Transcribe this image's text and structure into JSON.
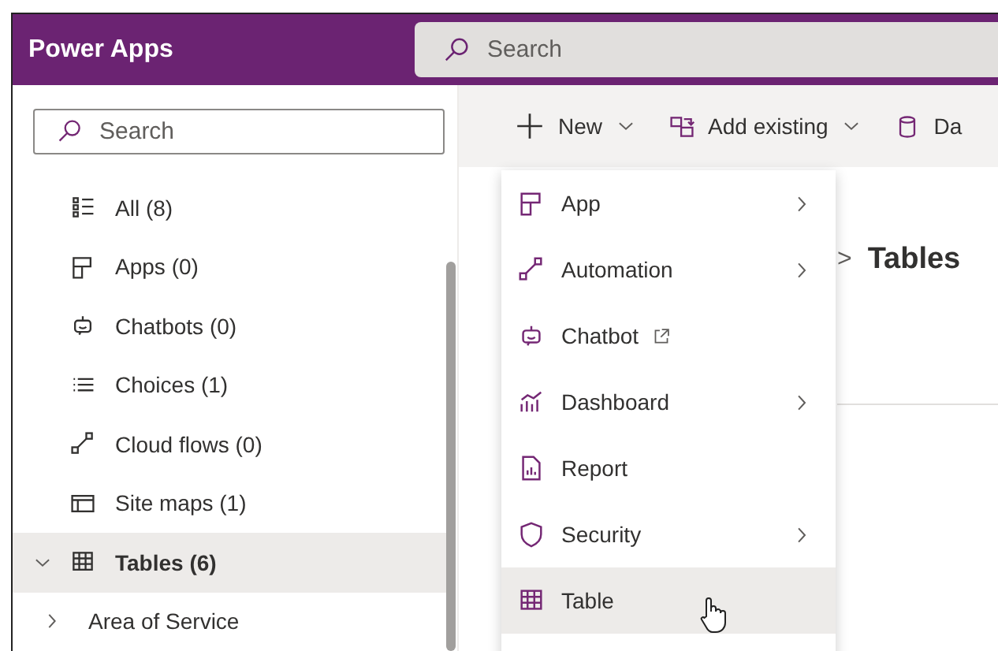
{
  "header": {
    "title": "Power Apps",
    "search": {
      "placeholder": "Search"
    }
  },
  "sidebar": {
    "search": {
      "placeholder": "Search"
    },
    "items": [
      {
        "label": "All",
        "count": "(8)",
        "selected": false
      },
      {
        "label": "Apps",
        "count": "(0)",
        "selected": false
      },
      {
        "label": "Chatbots",
        "count": "(0)",
        "selected": false
      },
      {
        "label": "Choices",
        "count": "(1)",
        "selected": false
      },
      {
        "label": "Cloud flows",
        "count": "(0)",
        "selected": false
      },
      {
        "label": "Site maps",
        "count": "(1)",
        "selected": false
      },
      {
        "label": "Tables",
        "count": "(6)",
        "selected": true,
        "expanded": true,
        "children": [
          {
            "label": "Area of Service",
            "expanded": false
          }
        ]
      }
    ]
  },
  "command_bar": [
    {
      "label": "New",
      "kind": "dropdown"
    },
    {
      "label": "Add existing",
      "kind": "dropdown"
    },
    {
      "label": "Da",
      "kind": "plain"
    }
  ],
  "breadcrumb": {
    "separator": ">",
    "current": "Tables"
  },
  "new_menu": [
    {
      "label": "App",
      "kind": "submenu",
      "hovered": false
    },
    {
      "label": "Automation",
      "kind": "submenu",
      "hovered": false
    },
    {
      "label": "Chatbot",
      "kind": "external",
      "hovered": false
    },
    {
      "label": "Dashboard",
      "kind": "submenu",
      "hovered": false
    },
    {
      "label": "Report",
      "kind": "plain",
      "hovered": false
    },
    {
      "label": "Security",
      "kind": "submenu",
      "hovered": false
    },
    {
      "label": "Table",
      "kind": "plain",
      "hovered": true
    }
  ]
}
